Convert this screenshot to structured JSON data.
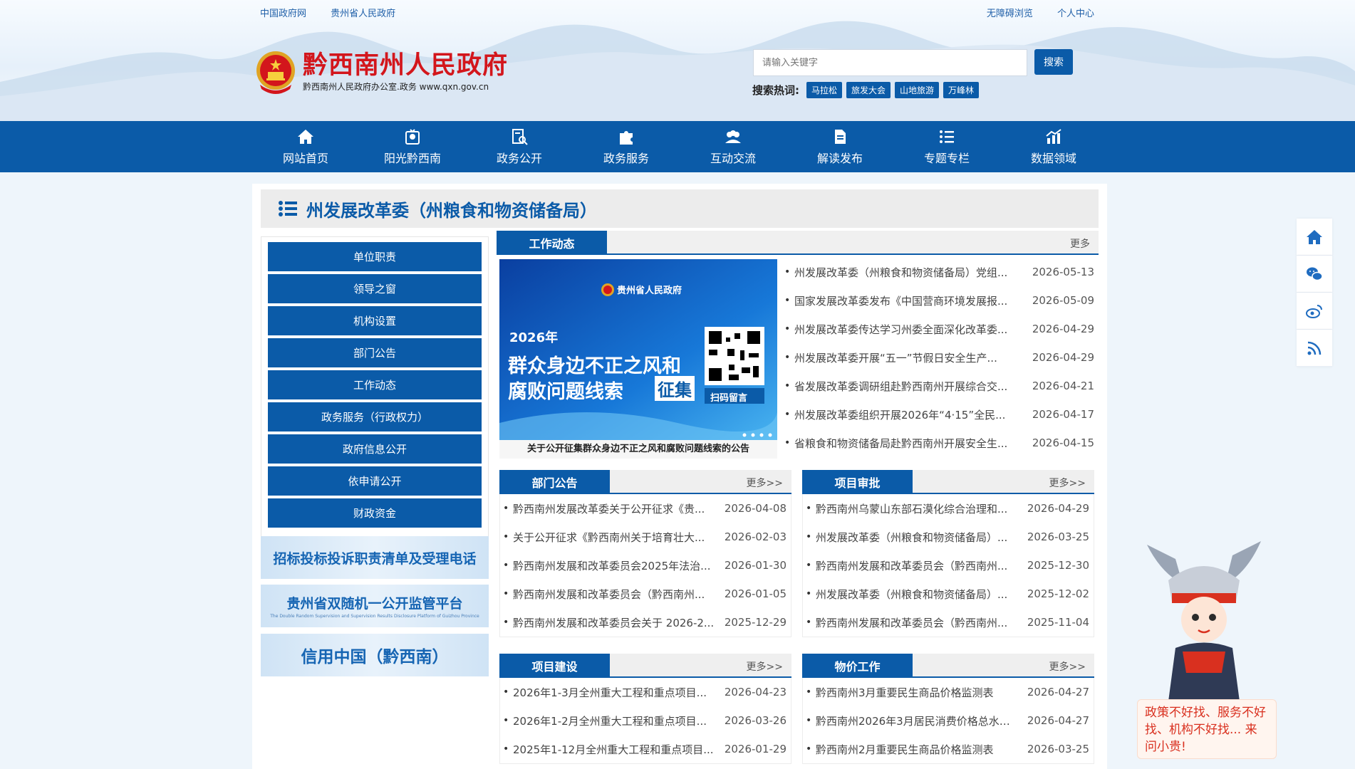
{
  "header": {
    "top_left_links": [
      "中国政府网",
      "贵州省人民政府"
    ],
    "top_right_links": [
      "无障碍浏览",
      "个人中心"
    ],
    "logo_title": "黔西南州人民政府",
    "logo_sub": "黔西南州人民政府办公室.政务  www.qxn.gov.cn",
    "search_placeholder": "请输入关键字",
    "search_button": "搜索",
    "hot_label": "搜索热词:",
    "hot_tags": [
      "马拉松",
      "旅发大会",
      "山地旅游",
      "万峰林"
    ]
  },
  "nav": [
    {
      "label": "网站首页",
      "icon": "home-icon"
    },
    {
      "label": "阳光黔西南",
      "icon": "sun-icon"
    },
    {
      "label": "政务公开",
      "icon": "document-search-icon"
    },
    {
      "label": "政务服务",
      "icon": "puzzle-icon"
    },
    {
      "label": "互动交流",
      "icon": "people-icon"
    },
    {
      "label": "解读发布",
      "icon": "file-icon"
    },
    {
      "label": "专题专栏",
      "icon": "list-icon"
    },
    {
      "label": "数据领域",
      "icon": "chart-icon"
    }
  ],
  "page_title": "州发展改革委（州粮食和物资储备局）",
  "sidebar": [
    "单位职责",
    "领导之窗",
    "机构设置",
    "部门公告",
    "工作动态",
    "政务服务（行政权力）",
    "政府信息公开",
    "依申请公开",
    "财政资金"
  ],
  "banners": {
    "b1": "招标投标投诉职责清单及受理电话",
    "b2": "贵州省双随机一公开监管平台",
    "b2_sub": "The Double Random Supervision and Supervision Results Disclosure Platform of Guizhou Province",
    "b3": "信用中国（黔西南）"
  },
  "work": {
    "tab": "工作动态",
    "more": "更多",
    "poster": {
      "org": "贵州省人民政府",
      "year": "2026年",
      "line1": "群众身边不正之风和",
      "line2": "腐败问题线索",
      "stamp": "征集",
      "qr_label": "扫码留言"
    },
    "caption": "关于公开征集群众身边不正之风和腐败问题线索的公告",
    "items": [
      {
        "t": "州发展改革委（州粮食和物资储备局）党组...",
        "d": "2026-05-13"
      },
      {
        "t": "国家发展改革委发布《中国营商环境发展报...",
        "d": "2026-05-09"
      },
      {
        "t": "州发展改革委传达学习州委全面深化改革委...",
        "d": "2026-04-29"
      },
      {
        "t": "州发展改革委开展“五一”节假日安全生产...",
        "d": "2026-04-29"
      },
      {
        "t": "省发展改革委调研组赴黔西南州开展综合交...",
        "d": "2026-04-21"
      },
      {
        "t": "州发展改革委组织开展2026年“4·15”全民...",
        "d": "2026-04-17"
      },
      {
        "t": "省粮食和物资储备局赴黔西南州开展安全生...",
        "d": "2026-04-15"
      }
    ]
  },
  "notice": {
    "tab": "部门公告",
    "more": "更多>>",
    "items": [
      {
        "t": "黔西南州发展改革委关于公开征求《贵...",
        "d": "2026-04-08"
      },
      {
        "t": "关于公开征求《黔西南州关于培育壮大...",
        "d": "2026-02-03"
      },
      {
        "t": "黔西南州发展和改革委员会2025年法治...",
        "d": "2026-01-30"
      },
      {
        "t": "黔西南州发展和改革委员会（黔西南州...",
        "d": "2026-01-05"
      },
      {
        "t": "黔西南州发展和改革委员会关于 2026-2...",
        "d": "2025-12-29"
      }
    ]
  },
  "approval": {
    "tab": "项目审批",
    "more": "更多>>",
    "items": [
      {
        "t": "黔西南州乌蒙山东部石漠化综合治理和...",
        "d": "2026-04-29"
      },
      {
        "t": "州发展改革委（州粮食和物资储备局）...",
        "d": "2026-03-25"
      },
      {
        "t": "黔西南州发展和改革委员会（黔西南州...",
        "d": "2025-12-30"
      },
      {
        "t": "州发展改革委（州粮食和物资储备局）...",
        "d": "2025-12-02"
      },
      {
        "t": "黔西南州发展和改革委员会（黔西南州...",
        "d": "2025-11-04"
      }
    ]
  },
  "construction": {
    "tab": "项目建设",
    "more": "更多>>",
    "items": [
      {
        "t": "2026年1-3月全州重大工程和重点项目...",
        "d": "2026-04-23"
      },
      {
        "t": "2026年1-2月全州重大工程和重点项目...",
        "d": "2026-03-26"
      },
      {
        "t": "2025年1-12月全州重大工程和重点项目...",
        "d": "2026-01-29"
      }
    ]
  },
  "price": {
    "tab": "物价工作",
    "more": "更多>>",
    "items": [
      {
        "t": "黔西南州3月重要民生商品价格监测表",
        "d": "2026-04-27"
      },
      {
        "t": "黔西南州2026年3月居民消费价格总水平...",
        "d": "2026-04-27"
      },
      {
        "t": "黔西南州2月重要民生商品价格监测表",
        "d": "2026-03-25"
      }
    ]
  },
  "float_bar": [
    "home-icon",
    "wechat-icon",
    "weibo-icon",
    "rss-icon"
  ],
  "mascot_bubble": "政策不好找、服务不好找、机构不好找... 来问小贵!",
  "colors": {
    "primary": "#0b5ba8",
    "logo_red": "#d3161c",
    "bubble_red": "#d9301f"
  }
}
